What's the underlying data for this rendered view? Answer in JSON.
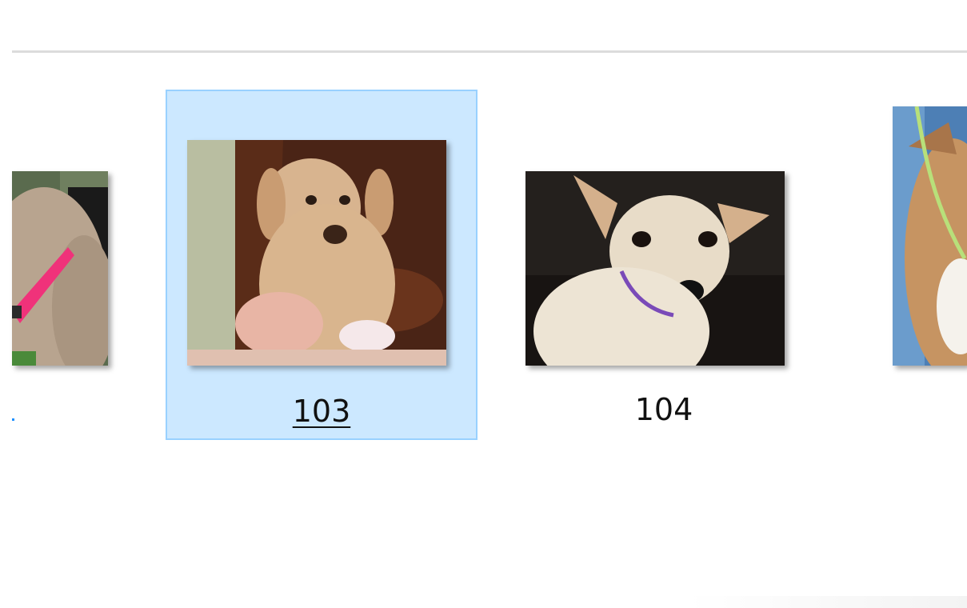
{
  "explorer": {
    "items": [
      {
        "label": ""
      },
      {
        "label": "103",
        "selected": true
      },
      {
        "label": "104",
        "selected": false
      },
      {
        "label": ""
      }
    ]
  },
  "colors": {
    "selection_fill": "#cce8ff",
    "selection_border": "#99d1ff",
    "divider": "#dcdcdc"
  },
  "icons": [
    "dog-thumbnail-left",
    "puppy-thumbnail",
    "chihuahua-thumbnail",
    "dog-thumbnail-right"
  ]
}
